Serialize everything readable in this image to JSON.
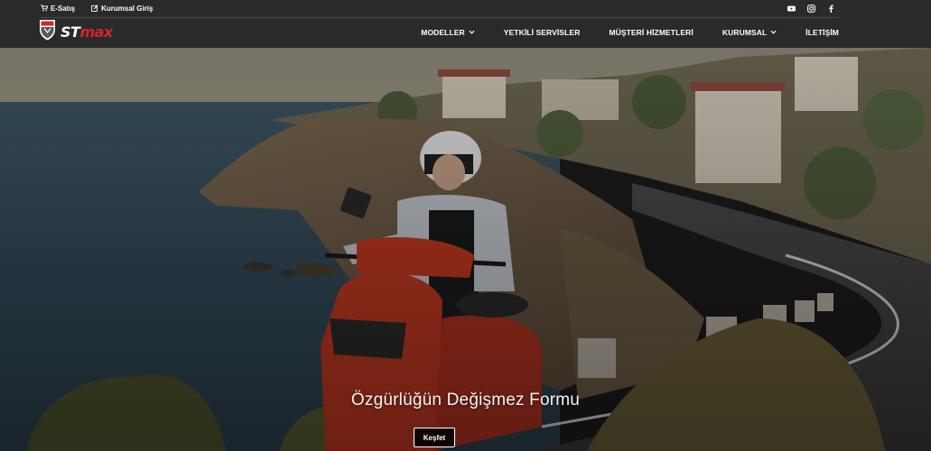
{
  "topbar": {
    "esatis_label": "E-Satış",
    "kurumsal_giris_label": "Kurumsal Giriş",
    "socials": [
      "youtube-icon",
      "instagram-icon",
      "facebook-icon"
    ]
  },
  "logo": {
    "st": "ST",
    "max": "max"
  },
  "nav": {
    "items": [
      {
        "label": "MODELLER",
        "dropdown": true
      },
      {
        "label": "YETKİLİ SERVİSLER",
        "dropdown": false
      },
      {
        "label": "MÜŞTERİ HİZMETLERİ",
        "dropdown": false
      },
      {
        "label": "KURUMSAL",
        "dropdown": true
      },
      {
        "label": "İLETİŞİM",
        "dropdown": false
      }
    ]
  },
  "hero": {
    "title": "Özgürlüğün Değişmez Formu",
    "button_label": "Keşfet"
  },
  "colors": {
    "header_bg": "#2a2a2a",
    "brand_red": "#d6242b",
    "scooter_red": "#c63a22"
  }
}
